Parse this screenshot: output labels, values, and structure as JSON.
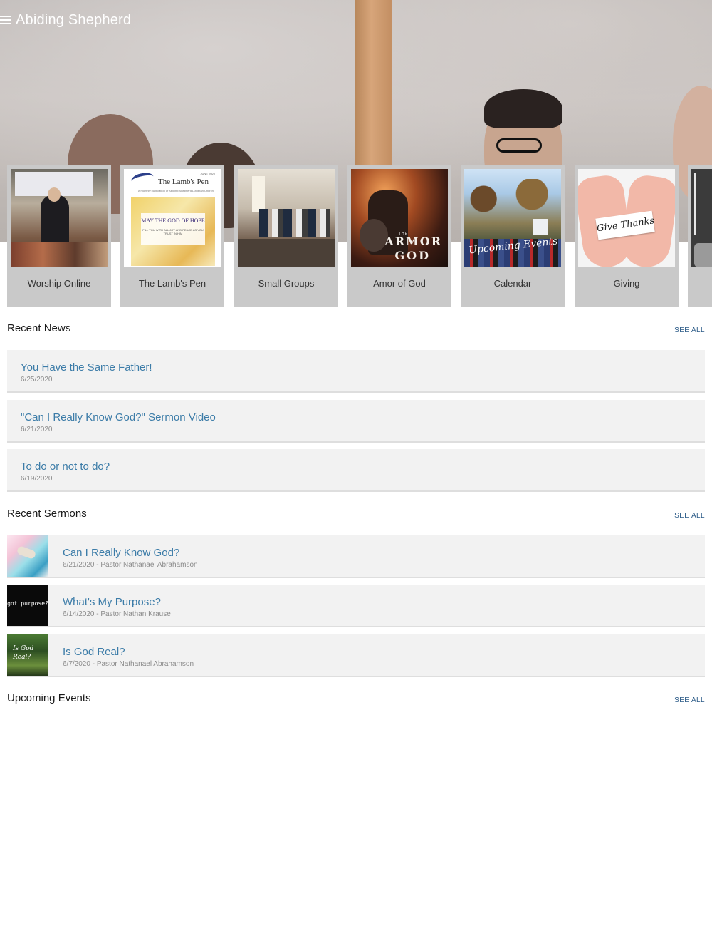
{
  "app": {
    "title": "Abiding Shepherd"
  },
  "tiles": [
    {
      "label": "Worship Online",
      "icon": "worship-photo"
    },
    {
      "label": "The Lamb's Pen",
      "icon": "newsletter-cover",
      "cover_title": "The Lamb's Pen",
      "cover_subtitle": "A monthly publication of Abiding Shepherd Lutheran Church",
      "cover_date": "JUNE 2020",
      "cover_heading": "MAY THE GOD OF HOPE",
      "cover_verse": "FILL YOU WITH ALL JOY AND PEACE AS YOU TRUST IN HIM"
    },
    {
      "label": "Small Groups",
      "icon": "small-groups-photo"
    },
    {
      "label": "Amor of God",
      "icon": "armor-of-god-art",
      "art_text_small": "THE",
      "art_text_1": "ARMOR",
      "art_text_2": "GOD"
    },
    {
      "label": "Calendar",
      "icon": "calendar-photo",
      "art_text": "Upcoming Events"
    },
    {
      "label": "Giving",
      "icon": "giving-hands-photo",
      "art_text": "Give Thanks"
    }
  ],
  "recent_news": {
    "title": "Recent News",
    "see_all": "SEE ALL",
    "items": [
      {
        "title": "You Have the Same Father!",
        "date": "6/25/2020"
      },
      {
        "title": "\"Can I Really Know God?\" Sermon Video",
        "date": "6/21/2020"
      },
      {
        "title": "To do or not to do?",
        "date": "6/19/2020"
      }
    ]
  },
  "recent_sermons": {
    "title": "Recent Sermons",
    "see_all": "SEE ALL",
    "items": [
      {
        "title": "Can I Really Know God?",
        "meta": "6/21/2020 - Pastor Nathanael Abrahamson"
      },
      {
        "title": "What's My Purpose?",
        "meta": "6/14/2020 - Pastor Nathan Krause",
        "thumb_text": "got purpose?"
      },
      {
        "title": "Is God Real?",
        "meta": "6/7/2020 - Pastor Nathanael Abrahamson",
        "thumb_text": "Is God Real?"
      }
    ]
  },
  "upcoming_events": {
    "title": "Upcoming Events",
    "see_all": "SEE ALL"
  }
}
